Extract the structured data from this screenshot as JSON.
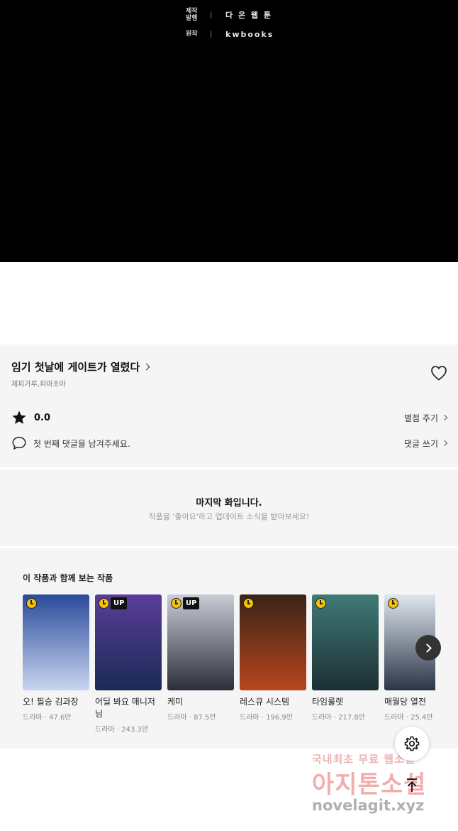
{
  "comic": {
    "credits": [
      {
        "key": "제작\n발행",
        "value": "다 온 웹 툰"
      },
      {
        "key": "원작",
        "value": "kwbooks"
      }
    ],
    "separator": "|"
  },
  "info": {
    "title": "임기 첫날에 게이트가 열렸다",
    "authors": "제피가루,피아조아",
    "rating": "0.0",
    "rate_link": "별점 주기",
    "comment_prompt": "첫 번째 댓글을 남겨주세요.",
    "comment_link": "댓글 쓰기"
  },
  "last_episode": {
    "title": "마지막 화입니다.",
    "subtitle": "작품을 '좋아요'하고 업데이트 소식을 받아보세요!"
  },
  "recommendations": {
    "heading": "이 작품과 함께 보는 작품",
    "items": [
      {
        "name": "오! 필승 김과장",
        "meta": "드라마 · 47.6만",
        "badge": "",
        "color_top": "#2a4a9a",
        "color_bottom": "#c9d6ef"
      },
      {
        "name": "어딜 봐요 매니저님",
        "meta": "드라마 · 243.3만",
        "badge": "UP",
        "color_top": "#5a3d9a",
        "color_bottom": "#1b2a55"
      },
      {
        "name": "케미",
        "meta": "드라마 · 87.5만",
        "badge": "UP",
        "color_top": "#c9ccd6",
        "color_bottom": "#2b2e38"
      },
      {
        "name": "레스큐 시스템",
        "meta": "드라마 · 196.9만",
        "badge": "",
        "color_top": "#3a2318",
        "color_bottom": "#b8461c"
      },
      {
        "name": "타임룰렛",
        "meta": "드라마 · 217.8만",
        "badge": "",
        "color_top": "#3f7a76",
        "color_bottom": "#1d2f35"
      },
      {
        "name": "매월당 열전",
        "meta": "드라마 · 25.4만",
        "badge": "",
        "color_top": "#dfe6ee",
        "color_bottom": "#2a3548"
      }
    ]
  },
  "watermark": {
    "line1": "국내최초 무료 웹소설",
    "line2": "아지톤소설",
    "line3": "novelagit.xyz"
  }
}
